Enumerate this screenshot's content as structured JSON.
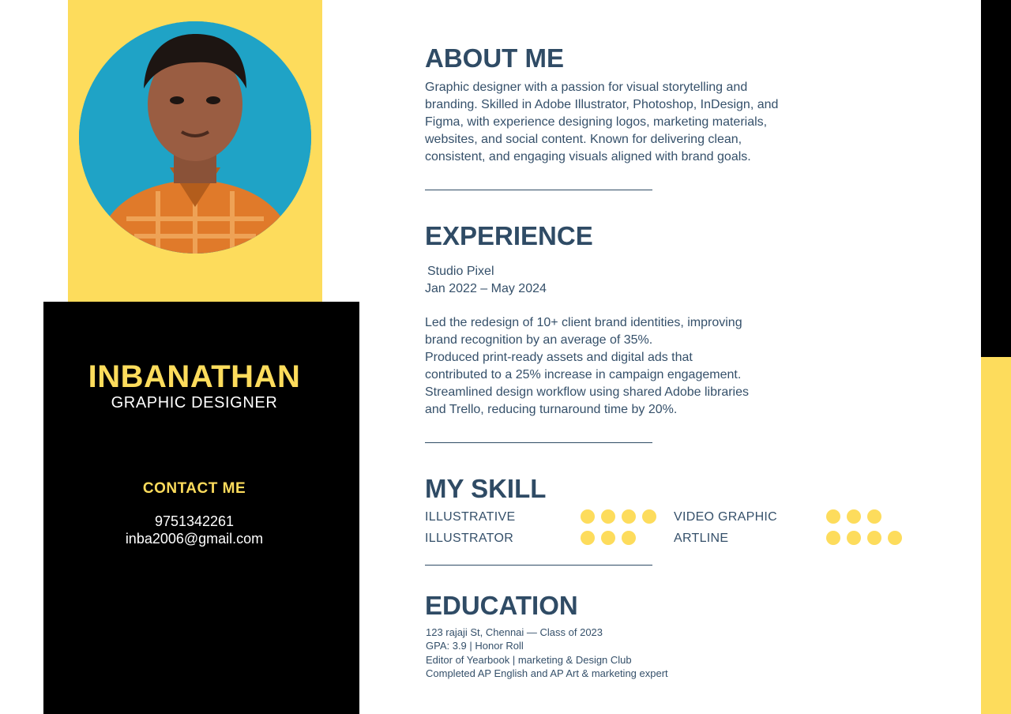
{
  "profile": {
    "name": "INBANATHAN",
    "role": "GRAPHIC DESIGNER"
  },
  "contact": {
    "title": "CONTACT ME",
    "phone": "9751342261",
    "email": "inba2006@gmail.com"
  },
  "about": {
    "title": "ABOUT ME",
    "lines": [
      "Graphic designer with a passion for visual storytelling and",
      "branding. Skilled in Adobe Illustrator, Photoshop, InDesign, and",
      "Figma, with experience designing logos, marketing materials,",
      "websites, and social content. Known for delivering clean,",
      "consistent, and engaging visuals aligned with brand goals."
    ]
  },
  "experience": {
    "title": "EXPERIENCE",
    "company": "Studio Pixel",
    "period": "Jan 2022 – May 2024",
    "lines": [
      "Led the redesign of 10+ client brand identities, improving",
      "brand recognition by an average of 35%.",
      "Produced print-ready assets and digital ads that",
      "contributed to a 25% increase in campaign engagement.",
      "Streamlined design workflow using shared Adobe libraries",
      "and Trello, reducing turnaround time by 20%."
    ]
  },
  "skills": {
    "title": "MY SKILL",
    "items": [
      {
        "label": "ILLUSTRATIVE",
        "level": 4
      },
      {
        "label": "VIDEO GRAPHIC",
        "level": 3
      },
      {
        "label": "ILLUSTRATOR",
        "level": 3
      },
      {
        "label": "ARTLINE",
        "level": 4
      }
    ]
  },
  "education": {
    "title": "EDUCATION",
    "lines": [
      "123 rajaji St, Chennai — Class of 2023",
      "GPA: 3.9 | Honor Roll",
      "Editor of Yearbook | marketing & Design Club",
      "Completed AP English and AP Art & marketing expert"
    ]
  },
  "colors": {
    "accent": "#FDDC5C",
    "heading": "#2f4b65",
    "panel": "#000000"
  }
}
